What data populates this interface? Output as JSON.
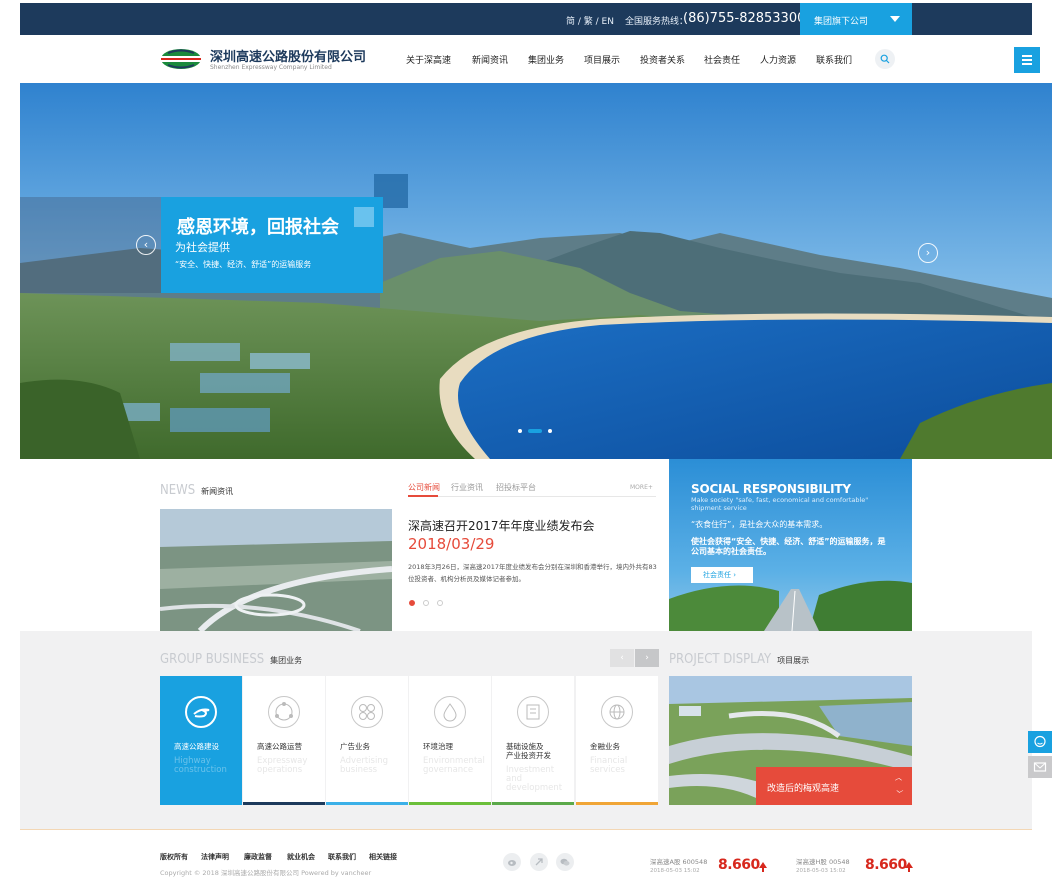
{
  "topbar": {
    "lang_switch": "简 / 繁 / EN",
    "hotline_label": "全国服务热线：",
    "hotline": "(86)755-82853300",
    "group_dropdown": "集团旗下公司"
  },
  "header": {
    "logo_cn": "深圳高速公路股份有限公司",
    "logo_en": "Shenzhen Expressway Company Limited",
    "nav": [
      "关于深高速",
      "新闻资讯",
      "集团业务",
      "项目展示",
      "投资者关系",
      "社会责任",
      "人力资源",
      "联系我们"
    ]
  },
  "banner": {
    "title": "感恩环境，回报社会",
    "subtitle": "为社会提供",
    "subtitle2": "“安全、快捷、经济、舒适”的运输服务",
    "prev": "‹",
    "next": "›"
  },
  "news": {
    "title_en": "NEWS",
    "title_cn": "新闻资讯",
    "tabs": [
      "公司新闻",
      "行业资讯",
      "招投标平台"
    ],
    "more": "MORE+",
    "headline": "深高速召开2017年年度业绩发布会",
    "date": "2018/03/29",
    "summary": "2018年3月26日，深高速2017年度业绩发布会分别在深圳和香港举行，境内外共有83位投资者、机构分析员及媒体记者参加。"
  },
  "social": {
    "title": "SOCIAL RESPONSIBILITY",
    "subtitle_en": "Make society \"safe, fast, economical and comfortable\" shipment service",
    "line1": "“衣食住行”，是社会大众的基本需求。",
    "line2": "使社会获得“安全、快捷、经济、舒适”的运输服务，是公司基本的社会责任。",
    "button": "社会责任  ›"
  },
  "group_business": {
    "title_en": "GROUP BUSINESS",
    "title_cn": "集团业务",
    "prev": "‹",
    "next": "›",
    "items": [
      {
        "cn": "高速公路建设",
        "en": "Highway construction",
        "bar": "#19a1e0"
      },
      {
        "cn": "高速公路运营",
        "en": "Expressway operations",
        "bar": "#1d3a5c"
      },
      {
        "cn": "广告业务",
        "en": "Advertising business",
        "bar": "#3bb0e8"
      },
      {
        "cn": "环境治理",
        "en": "Environmental governance",
        "bar": "#6bbf3a"
      },
      {
        "cn": "基础设施及\n产业投资开发",
        "en": "Investment and development",
        "bar": "#5ba94a"
      },
      {
        "cn": "金融业务",
        "en": "Financial services",
        "bar": "#f0a536"
      }
    ]
  },
  "project": {
    "title_en": "PROJECT DISPLAY",
    "title_cn": "项目展示",
    "caption": "改造后的梅观高速"
  },
  "footer": {
    "links": [
      "版权所有",
      "法律声明",
      "廉政监督",
      "就业机会",
      "联系我们",
      "相关链接"
    ],
    "copyright": "Copyright © 2018 深圳高速公路股份有限公司 Powered by vancheer",
    "stocks": [
      {
        "label": "深高速A股 600548",
        "date": "2018-05-03 15:02",
        "price": "8.660"
      },
      {
        "label": "深高速H股 00548",
        "date": "2018-05-03 15:02",
        "price": "8.660"
      }
    ]
  },
  "icons": [
    "search-icon",
    "menu-icon",
    "chevron-left-icon",
    "chevron-right-icon",
    "weibo-icon",
    "share-icon",
    "wechat-icon",
    "chat-icon",
    "message-icon"
  ]
}
